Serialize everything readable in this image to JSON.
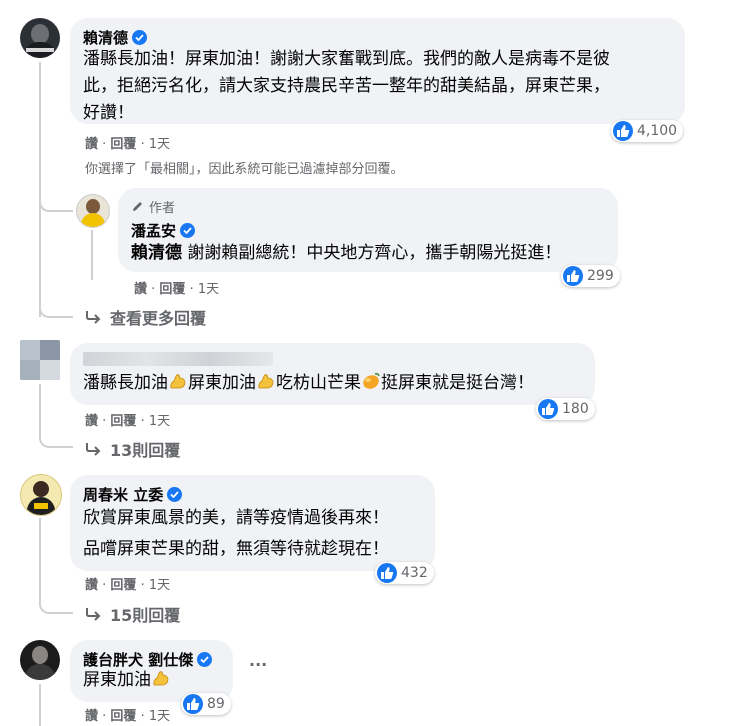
{
  "c1": {
    "name": "賴清德",
    "lines": [
      "潘縣長加油！屏東加油！謝謝大家奮戰到底。我們的敵人是病毒不是彼",
      "此，拒絕污名化，請大家支持農民辛苦一整年的甜美結晶，屏東芒果，",
      "好讚！"
    ],
    "like": "讚",
    "reply": "回覆",
    "time": "1天",
    "reactions": "4,100"
  },
  "filter_notice": "你選擇了「最相關」，因此系統可能已過濾掉部分回覆。",
  "c1_reply": {
    "author_tag": "作者",
    "name": "潘孟安",
    "mention": "賴清德",
    "text": " 謝謝賴副總統！中央地方齊心，攜手朝陽光挺進！",
    "like": "讚",
    "reply": "回覆",
    "time": "1天",
    "reactions": "299"
  },
  "view_more": "查看更多回覆",
  "c2": {
    "segments": [
      "潘縣長加油",
      "屏東加油",
      "吃枋山芒果",
      "挺屏東就是挺台灣！"
    ],
    "like": "讚",
    "reply": "回覆",
    "time": "1天",
    "reactions": "180",
    "replies_link": "13則回覆"
  },
  "c3": {
    "name": "周春米 立委",
    "line1": "欣賞屏東風景的美，請等疫情過後再來！",
    "line2": "品嚐屏東芒果的甜，無須等待就趁現在！",
    "like": "讚",
    "reply": "回覆",
    "time": "1天",
    "reactions": "432",
    "replies_link": "15則回覆"
  },
  "c4": {
    "name": "護台胖犬 劉仕傑",
    "text": "屏東加油",
    "like": "讚",
    "reply": "回覆",
    "time": "1天",
    "reactions": "89",
    "more": "···"
  },
  "colors": {
    "accent": "#1877f2",
    "bubble": "#f0f2f5",
    "meta": "#65676b"
  }
}
